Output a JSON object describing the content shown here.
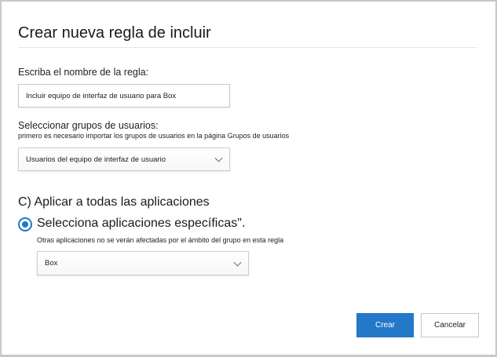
{
  "dialog": {
    "title": "Crear nueva regla de incluir",
    "rule_name_label": "Escriba el nombre de la regla:",
    "rule_name_value": "Incluir equipo de interfaz de usuario para Box",
    "groups_label": "Seleccionar grupos de usuarios:",
    "groups_hint": "primero es necesario importar los grupos de usuarios en la página Grupos de usuarios",
    "groups_selected": "Usuarios del equipo de interfaz de usuario",
    "apply_all_label": "C) Aplicar a todas las aplicaciones",
    "specific_apps_label": "Selecciona aplicaciones específicas\".",
    "specific_apps_hint": "Otras aplicaciones no se verán afectadas por el ámbito del grupo en esta regla",
    "app_selected": "Box",
    "create_button": "Crear",
    "cancel_button": "Cancelar"
  },
  "colors": {
    "accent": "#2378c8"
  }
}
